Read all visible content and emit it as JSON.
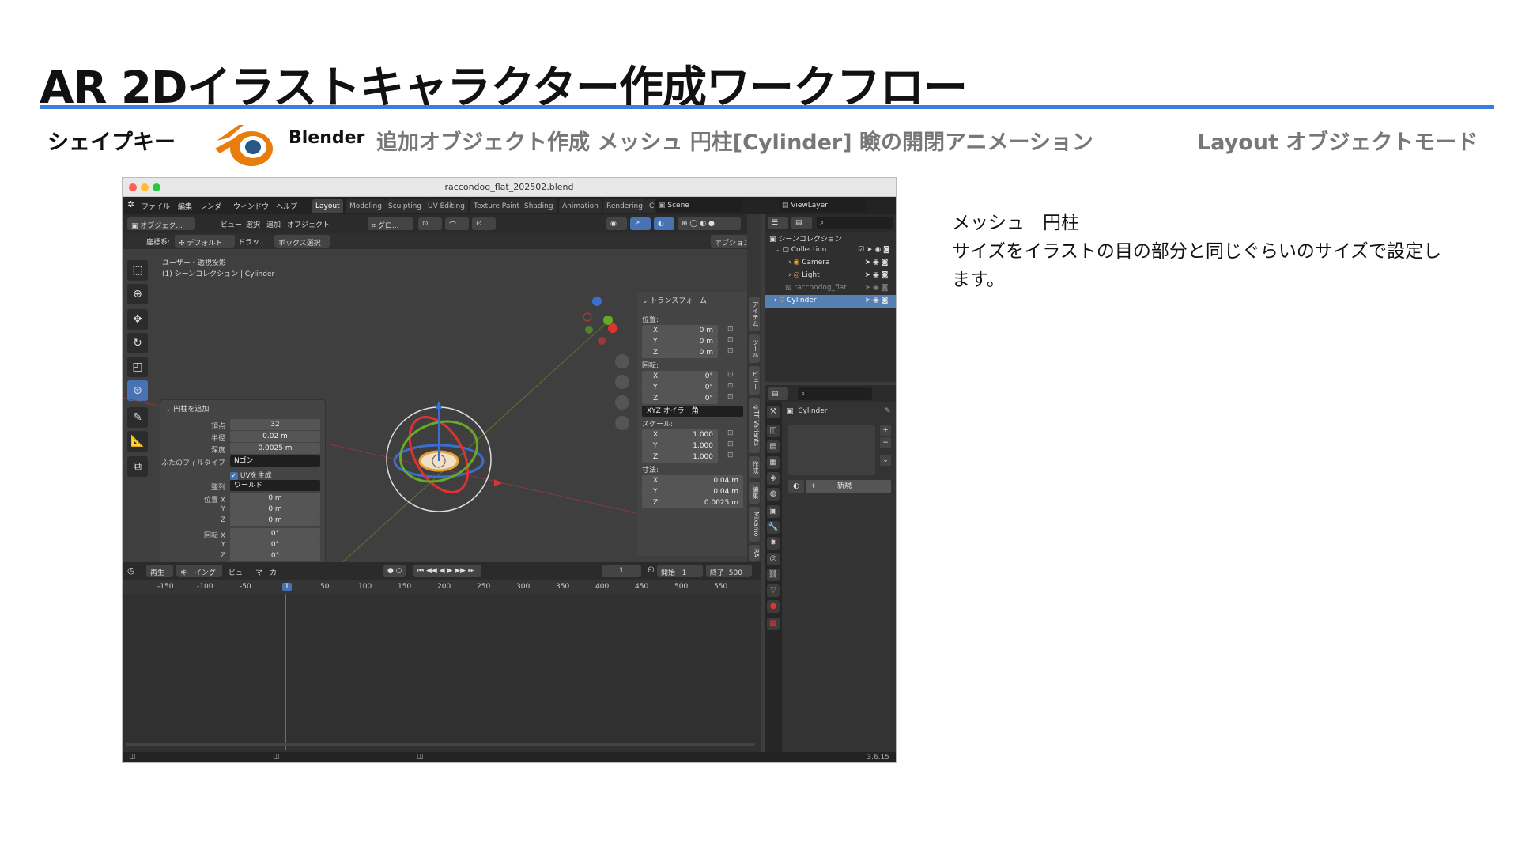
{
  "slide": {
    "title": "AR 2Dイラストキャラクター作成ワークフロー",
    "section_label": "シェイプキー",
    "app_name": "Blender",
    "step_description": "追加オブジェクト作成 メッシュ 円柱[Cylinder] 瞼の開閉アニメーション",
    "mode_label": "Layout オブジェクトモード",
    "notes": {
      "heading": "メッシュ　円柱",
      "line1": "サイズをイラストの目の部分と同じぐらいのサイズで設定し",
      "line2": "ます。"
    },
    "accent_color": "#3a7fe0"
  },
  "window": {
    "file_title": "raccondog_flat_202502.blend",
    "menu": [
      "ファイル",
      "編集",
      "レンダー",
      "ウィンドウ",
      "ヘルプ"
    ],
    "workspaces": [
      "Layout",
      "Modeling",
      "Sculpting",
      "UV Editing",
      "Texture Paint",
      "Shading",
      "Animation",
      "Rendering",
      "C"
    ],
    "scene": "Scene",
    "view_layer": "ViewLayer",
    "version": "3.6.15"
  },
  "viewport": {
    "mode": "オブジェク...",
    "menus": [
      "ビュー",
      "選択",
      "追加",
      "オブジェクト"
    ],
    "transform_orientation": "グロ...",
    "coord_label": "座標系:",
    "coord_value": "デフォルト",
    "drag_label": "ドラッ...",
    "box_select": "ボックス選択",
    "options": "オプション",
    "view_name": "ユーザー・透視投影",
    "collection_info": "(1) シーンコレクション | Cylinder"
  },
  "operator_panel": {
    "title": "円柱を追加",
    "vertices_label": "頂点",
    "vertices": "32",
    "radius_label": "半径",
    "radius": "0.02 m",
    "depth_label": "深度",
    "depth": "0.0025 m",
    "cap_label": "ふたのフィルタイプ",
    "cap": "Nゴン",
    "uv_label": "UVを生成",
    "align_label": "整列",
    "align": "ワールド",
    "loc_label": "位置 X",
    "loc_x": "0 m",
    "loc_y": "0 m",
    "loc_z": "0 m",
    "rot_label": "回転 X",
    "rot_x": "0°",
    "rot_y": "0°",
    "rot_z": "0°",
    "y_label": "Y",
    "z_label": "Z"
  },
  "n_panel": {
    "title": "トランスフォーム",
    "location_label": "位置:",
    "loc": [
      "0 m",
      "0 m",
      "0 m"
    ],
    "rotation_label": "回転:",
    "rot": [
      "0°",
      "0°",
      "0°"
    ],
    "rot_mode": "XYZ オイラー角",
    "scale_label": "スケール:",
    "scale": [
      "1.000",
      "1.000",
      "1.000"
    ],
    "dims_label": "寸法:",
    "dims": [
      "0.04 m",
      "0.04 m",
      "0.0025 m"
    ],
    "axes": [
      "X",
      "Y",
      "Z"
    ],
    "tabs": [
      "アイテム",
      "ツール",
      "ビュー",
      "glTF Variants",
      "作成",
      "編集",
      "Mixamo",
      "RA"
    ]
  },
  "timeline": {
    "menus": [
      "再生",
      "キーイング",
      "ビュー",
      "マーカー"
    ],
    "current_frame": "1",
    "start_label": "開始",
    "start": "1",
    "end_label": "終了",
    "end": "500",
    "ticks": [
      "-150",
      "-100",
      "-50",
      "1",
      "50",
      "100",
      "150",
      "200",
      "250",
      "300",
      "350",
      "400",
      "450",
      "500",
      "550"
    ]
  },
  "outliner": {
    "root": "シーンコレクション",
    "items": [
      "Collection",
      "Camera",
      "Light",
      "raccondog_flat",
      "Cylinder"
    ]
  },
  "properties": {
    "object_name": "Cylinder",
    "new_button": "新規"
  }
}
